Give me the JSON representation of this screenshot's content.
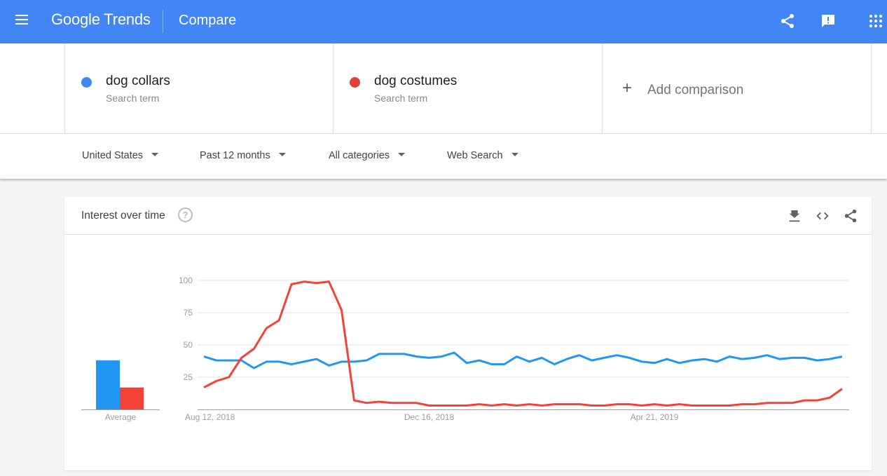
{
  "header": {
    "logo_google": "Google",
    "logo_trends": "Trends",
    "page_title": "Compare",
    "icons": [
      "menu-icon",
      "share-icon",
      "feedback-icon",
      "apps-grid-icon"
    ]
  },
  "terms": [
    {
      "name": "dog collars",
      "type": "Search term",
      "color": "#4285f4"
    },
    {
      "name": "dog costumes",
      "type": "Search term",
      "color": "#db4437"
    }
  ],
  "add_comparison": {
    "icon": "+",
    "label": "Add comparison"
  },
  "filters": {
    "region": "United States",
    "time_range": "Past 12 months",
    "category": "All categories",
    "search_type": "Web Search"
  },
  "card": {
    "title": "Interest over time",
    "help": "?",
    "actions": [
      "download-icon",
      "embed-icon",
      "share-icon"
    ]
  },
  "chart_data": {
    "type": "line",
    "title": "Interest over time",
    "xlabel": "",
    "ylabel": "",
    "ylim": [
      0,
      100
    ],
    "yticks": [
      25,
      50,
      75,
      100
    ],
    "grid": true,
    "x_tick_labels": [
      {
        "index": 0,
        "label": "Aug 12, 2018"
      },
      {
        "index": 18,
        "label": "Dec 16, 2018"
      },
      {
        "index": 36,
        "label": "Apr 21, 2019"
      }
    ],
    "x_count": 52,
    "x_interval": "weekly",
    "series": [
      {
        "name": "dog collars",
        "color": "#2196f3",
        "values": [
          41,
          38,
          38,
          38,
          32,
          37,
          37,
          35,
          37,
          39,
          34,
          37,
          37,
          38,
          43,
          43,
          43,
          41,
          40,
          41,
          44,
          36,
          38,
          35,
          35,
          41,
          37,
          40,
          35,
          39,
          42,
          38,
          40,
          42,
          40,
          37,
          36,
          39,
          36,
          38,
          39,
          37,
          41,
          39,
          40,
          42,
          39,
          40,
          40,
          38,
          39,
          41
        ]
      },
      {
        "name": "dog costumes",
        "color": "#f44336",
        "values": [
          17,
          22,
          25,
          40,
          47,
          63,
          69,
          97,
          99,
          98,
          99,
          77,
          7,
          5,
          6,
          5,
          5,
          5,
          3,
          3,
          3,
          3,
          4,
          3,
          4,
          3,
          4,
          3,
          4,
          4,
          4,
          3,
          3,
          4,
          4,
          3,
          4,
          3,
          4,
          3,
          3,
          3,
          3,
          4,
          4,
          5,
          5,
          5,
          7,
          7,
          9,
          16
        ]
      }
    ],
    "average": {
      "label": "Average",
      "values": [
        {
          "name": "dog collars",
          "value": 38,
          "color": "#2196f3"
        },
        {
          "name": "dog costumes",
          "value": 17,
          "color": "#f44336"
        }
      ]
    }
  }
}
